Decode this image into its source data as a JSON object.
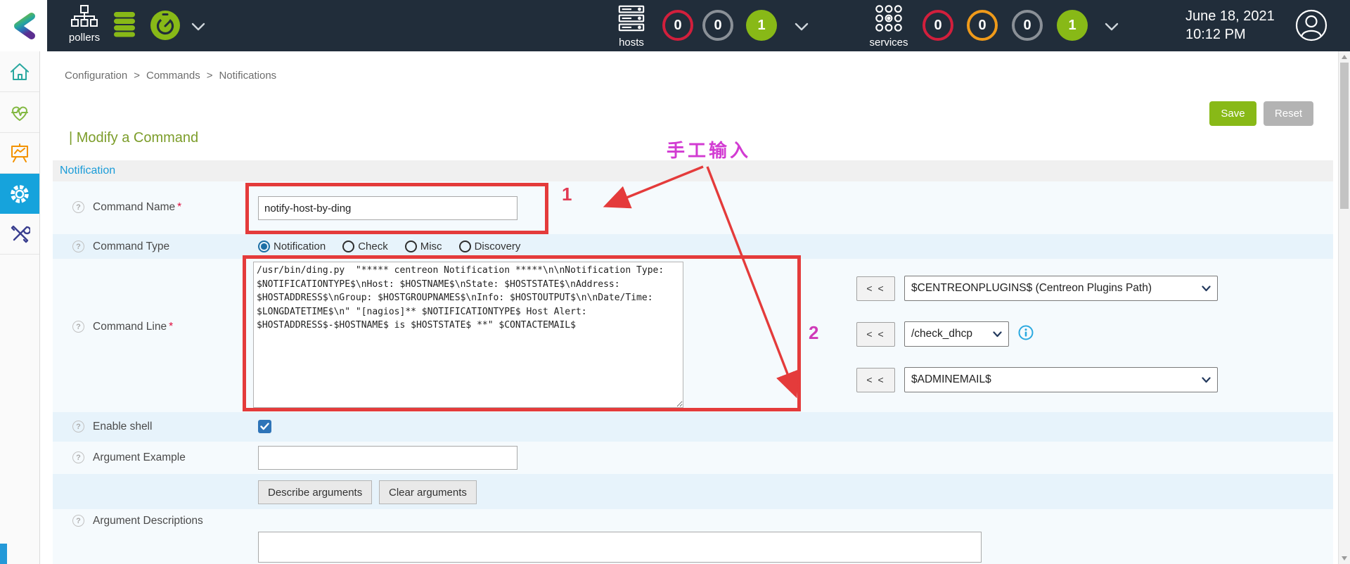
{
  "colors": {
    "header_bg": "#212d3a",
    "accent_green": "#88b917",
    "active_blue": "#16a3dc",
    "badge_red": "#d21f3c",
    "badge_orange": "#ef9a1a",
    "badge_gray": "#8a9097",
    "annotation_red": "#e43b3b",
    "annotation_magenta": "#d23bd2"
  },
  "header": {
    "pollers_label": "pollers",
    "hosts_label": "hosts",
    "services_label": "services",
    "hosts_badges": [
      {
        "value": "0",
        "style": "outline-red"
      },
      {
        "value": "0",
        "style": "outline-gray"
      },
      {
        "value": "1",
        "style": "filled-green"
      }
    ],
    "services_badges": [
      {
        "value": "0",
        "style": "outline-red"
      },
      {
        "value": "0",
        "style": "outline-orange"
      },
      {
        "value": "0",
        "style": "outline-gray"
      },
      {
        "value": "1",
        "style": "filled-green"
      }
    ],
    "date": "June 18, 2021",
    "time": "10:12 PM"
  },
  "breadcrumb": {
    "items": [
      "Configuration",
      "Commands",
      "Notifications"
    ],
    "sep": ">"
  },
  "actions": {
    "save": "Save",
    "reset": "Reset"
  },
  "page": {
    "title": "| Modify a Command",
    "tab": "Notification"
  },
  "form": {
    "command_name": {
      "label": "Command Name",
      "required_mark": "*",
      "value": "notify-host-by-ding"
    },
    "command_type": {
      "label": "Command Type",
      "options": [
        {
          "label": "Notification",
          "selected": true
        },
        {
          "label": "Check",
          "selected": false
        },
        {
          "label": "Misc",
          "selected": false
        },
        {
          "label": "Discovery",
          "selected": false
        }
      ]
    },
    "command_line": {
      "label": "Command Line",
      "required_mark": "*",
      "value": "/usr/bin/ding.py  \"***** centreon Notification *****\\n\\nNotification Type:\n$NOTIFICATIONTYPE$\\nHost: $HOSTNAME$\\nState: $HOSTSTATE$\\nAddress:\n$HOSTADDRESS$\\nGroup: $HOSTGROUPNAMES$\\nInfo: $HOSTOUTPUT$\\n\\nDate/Time:\n$LONGDATETIME$\\n\" \"[nagios]** $NOTIFICATIONTYPE$ Host Alert:\n$HOSTADDRESS$-$HOSTNAME$ is $HOSTSTATE$ **\" $CONTACTEMAIL$"
    },
    "macros": {
      "insert_label": "< <",
      "rows": [
        {
          "value": "$CENTREONPLUGINS$ (Centreon Plugins Path)"
        },
        {
          "value": "/check_dhcp"
        },
        {
          "value": "$ADMINEMAIL$"
        }
      ]
    },
    "enable_shell": {
      "label": "Enable shell",
      "checked": true
    },
    "argument_example": {
      "label": "Argument Example",
      "value": ""
    },
    "argument_buttons": {
      "describe": "Describe arguments",
      "clear": "Clear arguments"
    },
    "argument_descriptions": {
      "label": "Argument Descriptions",
      "value": ""
    }
  },
  "annotations": {
    "note": "手工输入",
    "marker1": "1",
    "marker2": "2"
  }
}
